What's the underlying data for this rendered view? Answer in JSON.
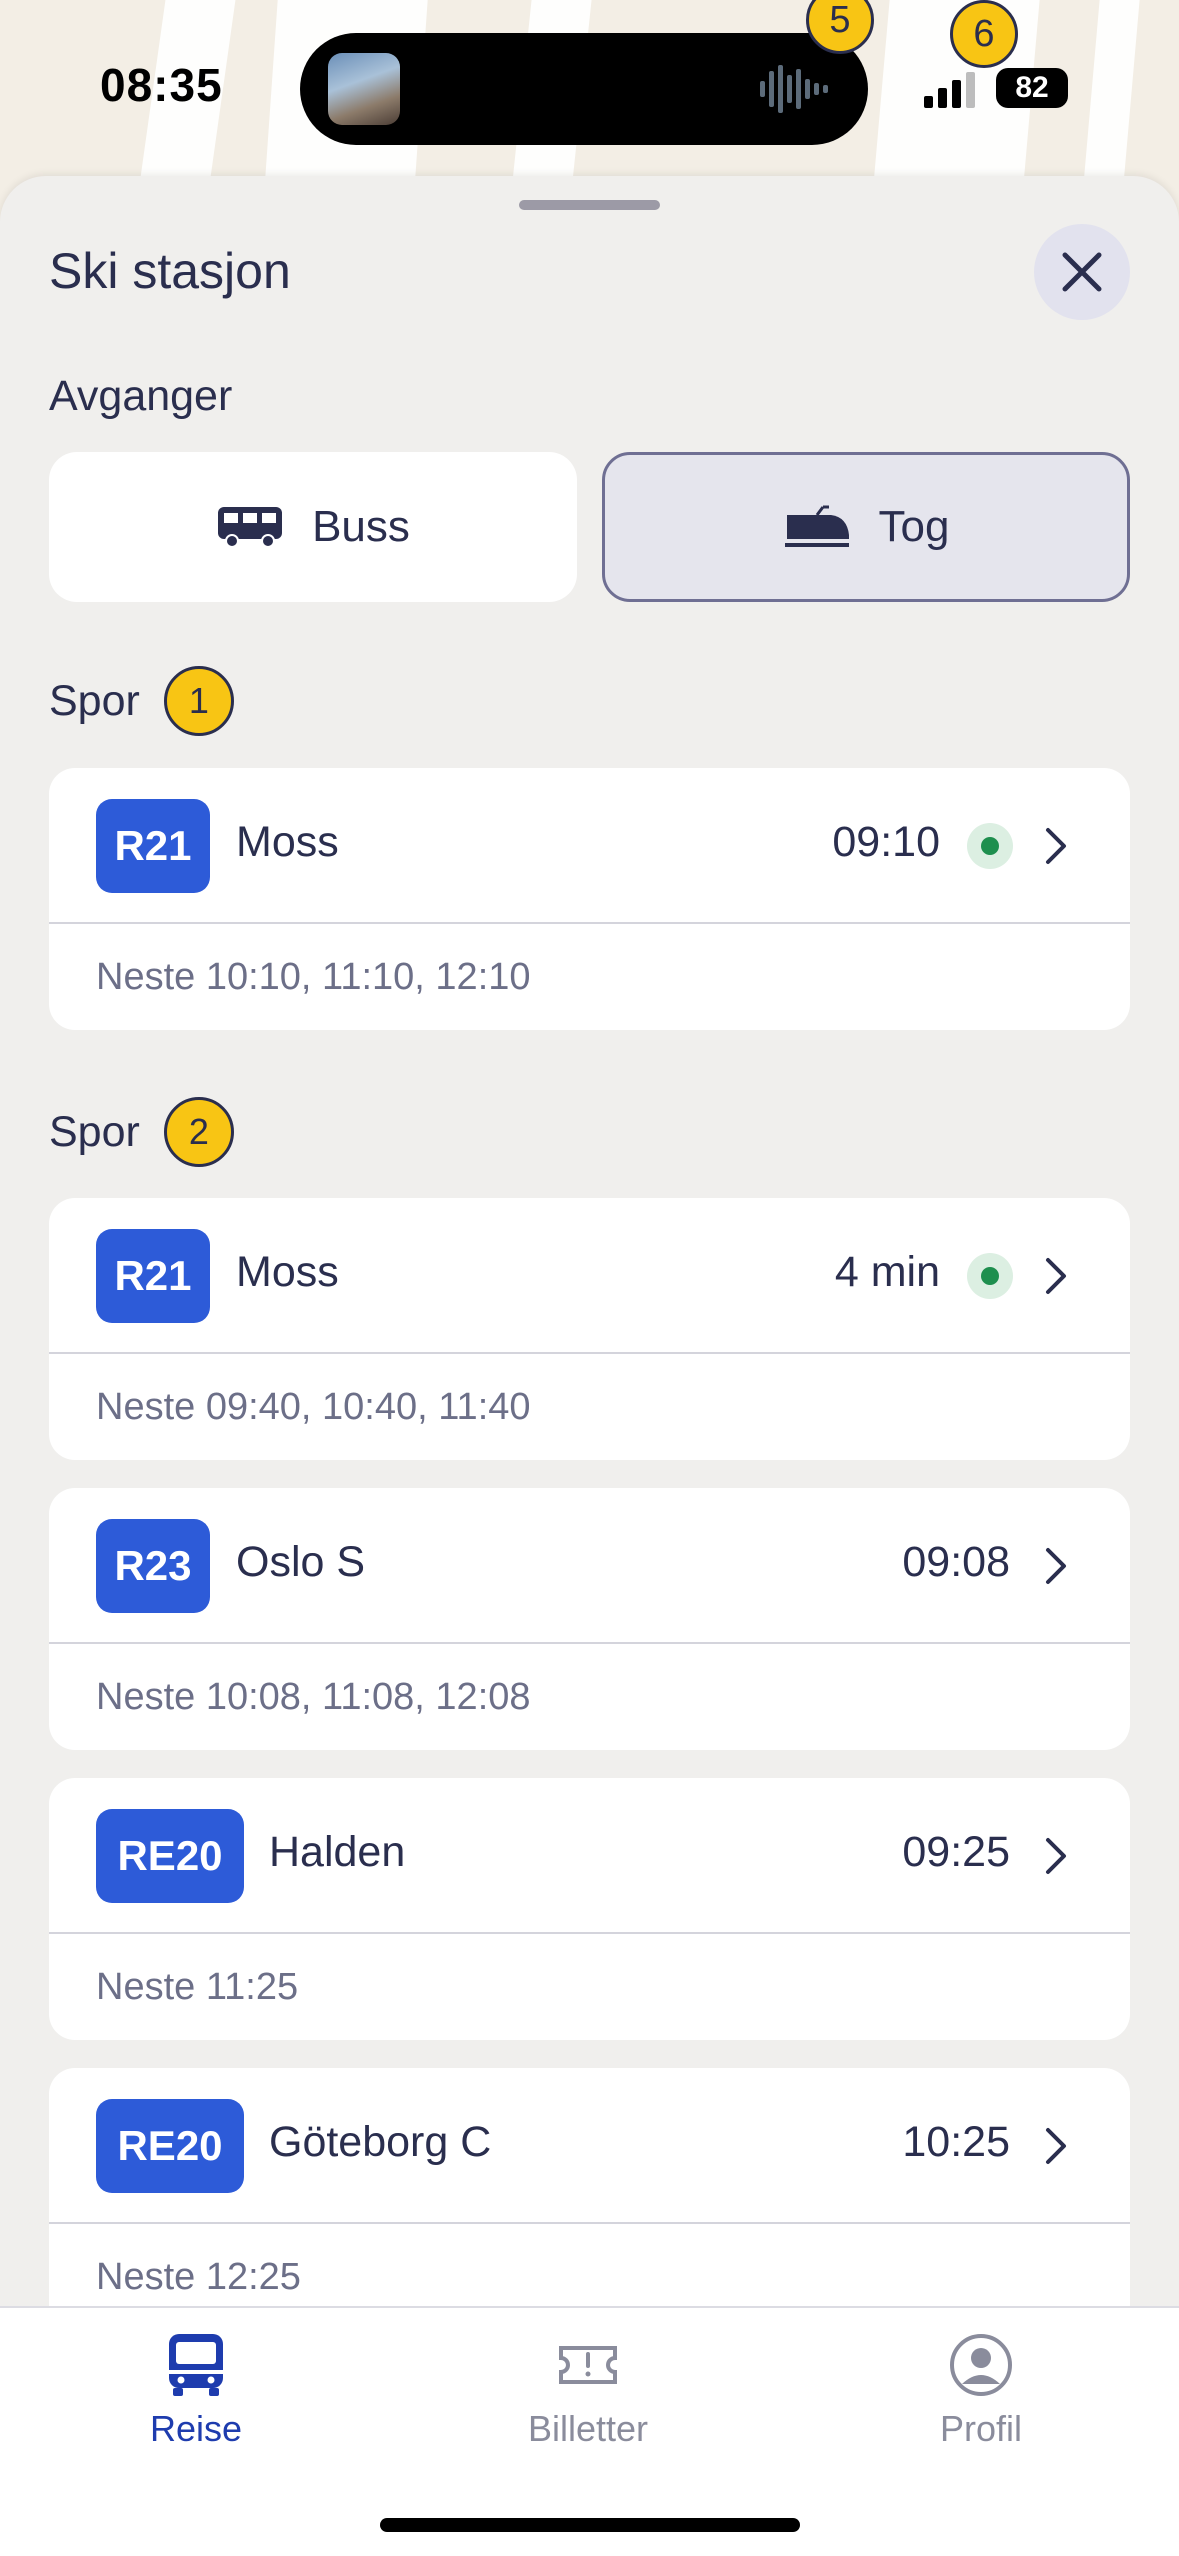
{
  "status_bar": {
    "time": "08:35",
    "badge_a": "5",
    "badge_b": "6",
    "battery": "82"
  },
  "sheet": {
    "title": "Ski stasjon",
    "departures_label": "Avganger",
    "modes": {
      "bus": "Buss",
      "train": "Tog",
      "selected": "Tog"
    }
  },
  "tracks": [
    {
      "label": "Spor",
      "number": "1",
      "departures": [
        {
          "line": "R21",
          "destination": "Moss",
          "time": "09:10",
          "realtime": true,
          "next": "Neste 10:10, 11:10, 12:10"
        }
      ]
    },
    {
      "label": "Spor",
      "number": "2",
      "departures": [
        {
          "line": "R21",
          "destination": "Moss",
          "time": "4 min",
          "realtime": true,
          "next": "Neste 09:40, 10:40, 11:40"
        },
        {
          "line": "R23",
          "destination": "Oslo S",
          "time": "09:08",
          "realtime": false,
          "next": "Neste 10:08, 11:08, 12:08"
        },
        {
          "line": "RE20",
          "destination": "Halden",
          "time": "09:25",
          "realtime": false,
          "next": "Neste 11:25"
        },
        {
          "line": "RE20",
          "destination": "Göteborg C",
          "time": "10:25",
          "realtime": false,
          "next": "Neste 12:25"
        }
      ]
    }
  ],
  "tabbar": {
    "tabs": [
      {
        "label": "Reise",
        "icon": "bus-icon",
        "active": true
      },
      {
        "label": "Billetter",
        "icon": "ticket-icon",
        "active": false
      },
      {
        "label": "Profil",
        "icon": "profile-icon",
        "active": false
      }
    ]
  },
  "colors": {
    "accent": "#2d5bd8",
    "active_tab": "#1e3cae",
    "inactive_tab": "#8a8c9c",
    "track_badge": "#f8c514",
    "realtime": "#1e8f4e"
  }
}
